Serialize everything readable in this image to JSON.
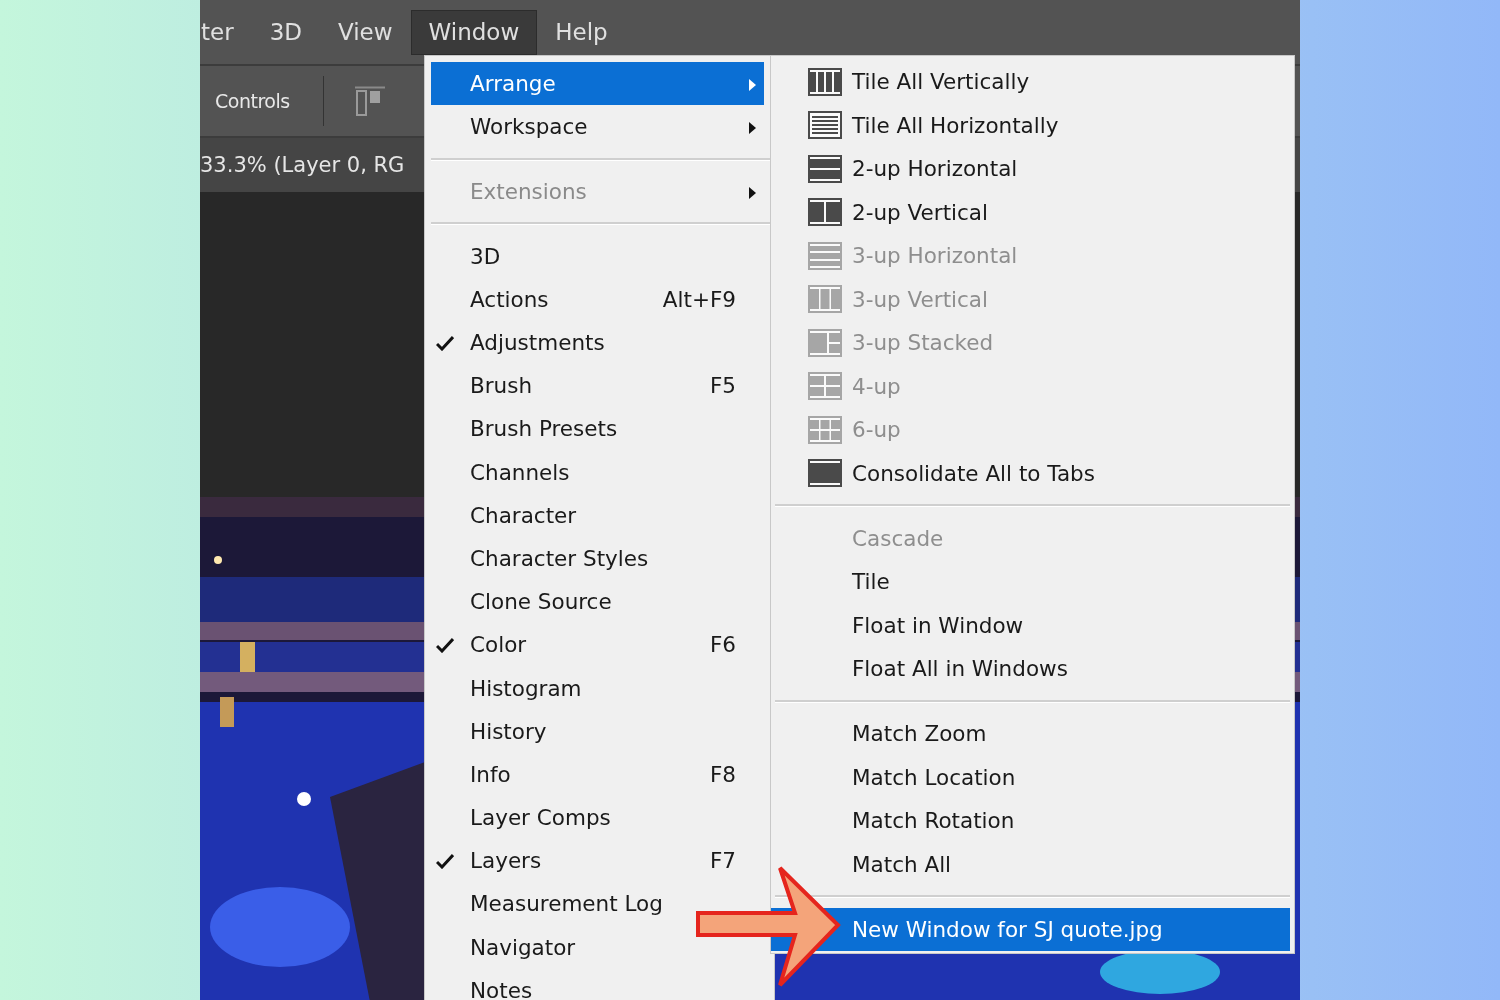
{
  "menubar": [
    {
      "label": "ter",
      "selected": false
    },
    {
      "label": "3D",
      "selected": false
    },
    {
      "label": "View",
      "selected": false
    },
    {
      "label": "Window",
      "selected": true
    },
    {
      "label": "Help",
      "selected": false
    }
  ],
  "options_bar": {
    "label": "Controls"
  },
  "document_tab": {
    "title": "33.3% (Layer 0, RG"
  },
  "window_menu": [
    {
      "kind": "item",
      "label": "Arrange",
      "has_submenu": true,
      "selected": true,
      "disabled": false,
      "checked": false
    },
    {
      "kind": "item",
      "label": "Workspace",
      "has_submenu": true,
      "selected": false,
      "disabled": false,
      "checked": false
    },
    {
      "kind": "separator"
    },
    {
      "kind": "item",
      "label": "Extensions",
      "has_submenu": true,
      "selected": false,
      "disabled": true,
      "checked": false
    },
    {
      "kind": "separator"
    },
    {
      "kind": "item",
      "label": "3D",
      "selected": false,
      "disabled": false,
      "checked": false
    },
    {
      "kind": "item",
      "label": "Actions",
      "shortcut": "Alt+F9",
      "selected": false,
      "disabled": false,
      "checked": false
    },
    {
      "kind": "item",
      "label": "Adjustments",
      "selected": false,
      "disabled": false,
      "checked": true
    },
    {
      "kind": "item",
      "label": "Brush",
      "shortcut": "F5",
      "selected": false,
      "disabled": false,
      "checked": false
    },
    {
      "kind": "item",
      "label": "Brush Presets",
      "selected": false,
      "disabled": false,
      "checked": false
    },
    {
      "kind": "item",
      "label": "Channels",
      "selected": false,
      "disabled": false,
      "checked": false
    },
    {
      "kind": "item",
      "label": "Character",
      "selected": false,
      "disabled": false,
      "checked": false
    },
    {
      "kind": "item",
      "label": "Character Styles",
      "selected": false,
      "disabled": false,
      "checked": false
    },
    {
      "kind": "item",
      "label": "Clone Source",
      "selected": false,
      "disabled": false,
      "checked": false
    },
    {
      "kind": "item",
      "label": "Color",
      "shortcut": "F6",
      "selected": false,
      "disabled": false,
      "checked": true
    },
    {
      "kind": "item",
      "label": "Histogram",
      "selected": false,
      "disabled": false,
      "checked": false
    },
    {
      "kind": "item",
      "label": "History",
      "selected": false,
      "disabled": false,
      "checked": false
    },
    {
      "kind": "item",
      "label": "Info",
      "shortcut": "F8",
      "selected": false,
      "disabled": false,
      "checked": false
    },
    {
      "kind": "item",
      "label": "Layer Comps",
      "selected": false,
      "disabled": false,
      "checked": false
    },
    {
      "kind": "item",
      "label": "Layers",
      "shortcut": "F7",
      "selected": false,
      "disabled": false,
      "checked": true
    },
    {
      "kind": "item",
      "label": "Measurement Log",
      "selected": false,
      "disabled": false,
      "checked": false
    },
    {
      "kind": "item",
      "label": "Navigator",
      "selected": false,
      "disabled": false,
      "checked": false
    },
    {
      "kind": "item",
      "label": "Notes",
      "selected": false,
      "disabled": false,
      "checked": false
    }
  ],
  "arrange_submenu": [
    {
      "kind": "layout",
      "label": "Tile All Vertically",
      "selected": false,
      "disabled": false
    },
    {
      "kind": "layout",
      "label": "Tile All Horizontally",
      "selected": false,
      "disabled": false
    },
    {
      "kind": "layout",
      "label": "2-up Horizontal",
      "selected": false,
      "disabled": false
    },
    {
      "kind": "layout",
      "label": "2-up Vertical",
      "selected": false,
      "disabled": false
    },
    {
      "kind": "layout",
      "label": "3-up Horizontal",
      "selected": false,
      "disabled": true
    },
    {
      "kind": "layout",
      "label": "3-up Vertical",
      "selected": false,
      "disabled": true
    },
    {
      "kind": "layout",
      "label": "3-up Stacked",
      "selected": false,
      "disabled": true
    },
    {
      "kind": "layout",
      "label": "4-up",
      "selected": false,
      "disabled": true
    },
    {
      "kind": "layout",
      "label": "6-up",
      "selected": false,
      "disabled": true
    },
    {
      "kind": "layout",
      "label": "Consolidate All to Tabs",
      "selected": false,
      "disabled": false
    },
    {
      "kind": "separator"
    },
    {
      "kind": "item",
      "label": "Cascade",
      "selected": false,
      "disabled": true
    },
    {
      "kind": "item",
      "label": "Tile",
      "selected": false,
      "disabled": false
    },
    {
      "kind": "item",
      "label": "Float in Window",
      "selected": false,
      "disabled": false
    },
    {
      "kind": "item",
      "label": "Float All in Windows",
      "selected": false,
      "disabled": false
    },
    {
      "kind": "separator"
    },
    {
      "kind": "item",
      "label": "Match Zoom",
      "selected": false,
      "disabled": false
    },
    {
      "kind": "item",
      "label": "Match Location",
      "selected": false,
      "disabled": false
    },
    {
      "kind": "item",
      "label": "Match Rotation",
      "selected": false,
      "disabled": false
    },
    {
      "kind": "item",
      "label": "Match All",
      "selected": false,
      "disabled": false
    },
    {
      "kind": "separator"
    },
    {
      "kind": "item",
      "label": "New Window for SJ quote.jpg",
      "selected": true,
      "disabled": false
    }
  ]
}
